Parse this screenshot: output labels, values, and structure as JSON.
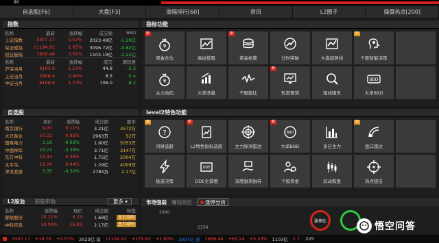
{
  "top_strip": {
    "number": "86"
  },
  "nav_tabs": [
    "自选股[F6]",
    "大盘[F3]",
    "涨幅排行[60]",
    "资讯",
    "L2圈子",
    "操盘热点[200]"
  ],
  "indices": {
    "title": "指数",
    "headers": [
      "名称",
      "最新",
      "涨跌幅",
      "成交额",
      "BBD"
    ],
    "rows": [
      [
        "上证指数",
        "3307.17",
        "0.57%",
        "2023.49亿",
        "-1.29亿"
      ],
      [
        "深证成指",
        "11194.91",
        "1.65%",
        "3096.72亿",
        "-0.82亿"
      ],
      [
        "创业板指",
        "1856.46",
        "3.51%",
        "1103.19亿",
        "-2.22亿"
      ]
    ],
    "futures_headers": [
      "名称",
      "最新",
      "涨跌幅",
      "成交",
      "期现差"
    ],
    "futures": [
      [
        "沪深当月",
        "4103.6",
        "1.10%",
        "44.8",
        "-5.3"
      ],
      [
        "上证当月",
        "2808.4",
        "0.44%",
        "8.5",
        "-5.4"
      ],
      [
        "中证当月",
        "6198.8",
        "1.74%",
        "106.0",
        "-8.2"
      ]
    ]
  },
  "watchlist": {
    "title": "自选股",
    "headers": [
      "名称",
      "现价",
      "涨跌幅",
      "成交额",
      "股本"
    ],
    "rows": [
      [
        "南京银行",
        "9.00",
        "0.11%",
        "3.21亿",
        "3572万"
      ],
      [
        "大元泵业",
        "57.22",
        "0.92%",
        "2963万",
        "52万"
      ],
      [
        "国电电力",
        "3.16",
        "-0.63%",
        "1.60亿",
        "5053万"
      ],
      [
        "中国神华",
        "23.21",
        "-0.39%",
        "3.71亿",
        "3147万"
      ],
      [
        "东方中科",
        "19.44",
        "0.39%",
        "1.75亿",
        "2004万"
      ],
      [
        "太平鸟",
        "19.24",
        "0.44%",
        "1.29亿",
        "4009万"
      ],
      [
        "津滨发展",
        "3.35",
        "-0.30%",
        "2784万",
        "2.17亿"
      ]
    ]
  },
  "l2pool": {
    "tab1": "L2股池",
    "tab2": "新股申购",
    "more": "更多",
    "headers": [
      "名称",
      "涨跌幅",
      "现价",
      "成交额",
      "标签"
    ],
    "rows": [
      [
        "御银股份",
        "10.11%",
        "5.23",
        "1.69亿",
        "主力动向"
      ],
      [
        "中科信息",
        "10.00%",
        "16.83",
        "2.17亿",
        "主力动向"
      ]
    ]
  },
  "features": {
    "title": "指标功能",
    "tiles": [
      {
        "label": "资金仓位",
        "icon": "money-bag-icon",
        "badge": "新"
      },
      {
        "label": "高抛低吸",
        "icon": "chart-trend-icon",
        "badge": ""
      },
      {
        "label": "资金抢筹",
        "icon": "coin-stack-icon",
        "badge": "新"
      },
      {
        "label": "分时突破",
        "icon": "breakout-icon",
        "badge": ""
      },
      {
        "label": "大盘趋势线",
        "icon": "trend-line-icon",
        "badge": ""
      },
      {
        "label": "个股智能决策",
        "icon": "decision-head-icon",
        "badge": "热"
      },
      {
        "label": "",
        "icon": "",
        "badge": ""
      },
      {
        "label": "主力动向",
        "icon": "money-bag-icon",
        "badge": ""
      },
      {
        "label": "大单净量",
        "icon": "bar-arrow-icon",
        "badge": ""
      },
      {
        "label": "千股股比",
        "icon": "wave-icon",
        "badge": ""
      },
      {
        "label": "形态预测",
        "icon": "screen-icon",
        "badge": "新"
      },
      {
        "label": "短线精灵",
        "icon": "magnifier-icon",
        "badge": ""
      },
      {
        "label": "大单BBD",
        "icon": "bbd-icon",
        "badge": ""
      },
      {
        "label": "",
        "icon": "",
        "badge": ""
      }
    ]
  },
  "level2": {
    "title": "level2特色功能",
    "tiles": [
      {
        "label": "问财选股",
        "icon": "question-icon",
        "badge": "热"
      },
      {
        "label": "L2特色指标选股",
        "icon": "doc-chart-icon",
        "badge": "新"
      },
      {
        "label": "主力探测雷达",
        "icon": "target-icon",
        "badge": ""
      },
      {
        "label": "大单BBD",
        "icon": "bbd-globe-icon",
        "badge": "新"
      },
      {
        "label": "多日主力",
        "icon": "bar-grid-icon",
        "badge": ""
      },
      {
        "label": "盘口雷达",
        "icon": "radar-icon",
        "badge": "热"
      },
      {
        "label": "",
        "icon": "",
        "badge": ""
      },
      {
        "label": "极速决策",
        "icon": "lightning-icon",
        "badge": ""
      },
      {
        "label": "DDE全景图",
        "icon": "dde-icon",
        "badge": ""
      },
      {
        "label": "深度融资融券",
        "icon": "money-hand-icon",
        "badge": ""
      },
      {
        "label": "个股资金",
        "icon": "coin-person-icon",
        "badge": ""
      },
      {
        "label": "异动看盘",
        "icon": "candlestick-icon",
        "badge": ""
      },
      {
        "label": "热点狙击",
        "icon": "crosshair-icon",
        "badge": ""
      },
      {
        "label": "",
        "icon": "",
        "badge": ""
      }
    ]
  },
  "market": {
    "tab1": "市场强弱",
    "tab2": "赚钱效应",
    "analysis": "涨停分析",
    "axis_top": "2000",
    "axis_mid": "1334",
    "circle1": "涨停比",
    "circle2": ""
  },
  "statusbar": {
    "items": [
      {
        "text": "3307.17",
        "color": "#ff3b3b"
      },
      {
        "text": "+18.76",
        "color": "#ff3b3b"
      },
      {
        "text": "+0.57%",
        "color": "#ff3b3b"
      },
      {
        "text": "2023亿 深",
        "color": "#d8d8d8"
      },
      {
        "text": "11194.91",
        "color": "#ff3b3b"
      },
      {
        "text": "+175.83",
        "color": "#ff3b3b"
      },
      {
        "text": "+1.60%",
        "color": "#ff3b3b"
      },
      {
        "text": "3097亿 创",
        "color": "#2a7fff"
      },
      {
        "text": "1856.46",
        "color": "#ff3b3b"
      },
      {
        "text": "+63.24",
        "color": "#ff3b3b"
      },
      {
        "text": "+3.53%",
        "color": "#ff3b3b"
      },
      {
        "text": "1103亿",
        "color": "#d8d8d8"
      },
      {
        "text": "2 ↑",
        "color": "#ff3b3b"
      },
      {
        "text": "225",
        "color": "#d8d8d8"
      }
    ]
  },
  "watermark": {
    "text": "悟空问答"
  },
  "colors": {
    "red": "#ff3b3b",
    "green": "#2ecc40",
    "badge_new": "#d6261b",
    "badge_hot": "#e2991b",
    "tile_bg": "#3a3a3a"
  }
}
